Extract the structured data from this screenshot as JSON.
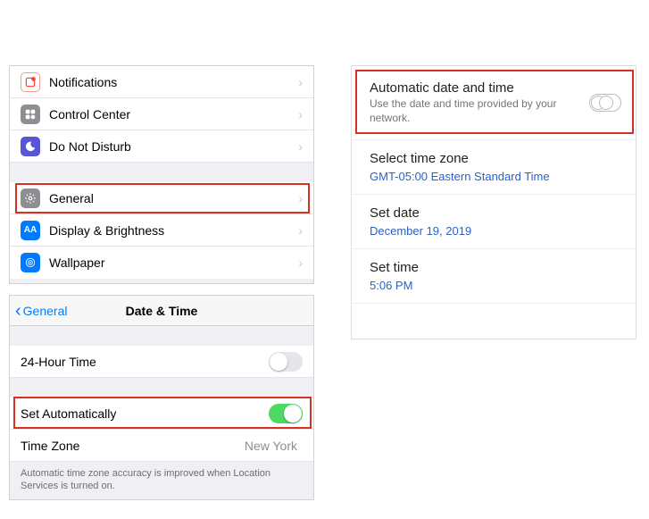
{
  "ios_settings": {
    "rows": [
      {
        "label": "Notifications"
      },
      {
        "label": "Control Center"
      },
      {
        "label": "Do Not Disturb"
      }
    ],
    "rows2": [
      {
        "label": "General"
      },
      {
        "label": "Display & Brightness"
      },
      {
        "label": "Wallpaper"
      }
    ]
  },
  "ios_datetime": {
    "back_label": "General",
    "title": "Date & Time",
    "row_24h": "24-Hour Time",
    "row_auto": "Set Automatically",
    "row_tz_label": "Time Zone",
    "row_tz_value": "New York",
    "footer": "Automatic time zone accuracy is improved when Location Services is turned on."
  },
  "android": {
    "auto": {
      "title": "Automatic date and time",
      "sub": "Use the date and time provided by your network."
    },
    "tz": {
      "title": "Select time zone",
      "sub": "GMT-05:00 Eastern Standard Time"
    },
    "date": {
      "title": "Set date",
      "sub": "December 19, 2019"
    },
    "time": {
      "title": "Set time",
      "sub": "5:06 PM"
    }
  }
}
